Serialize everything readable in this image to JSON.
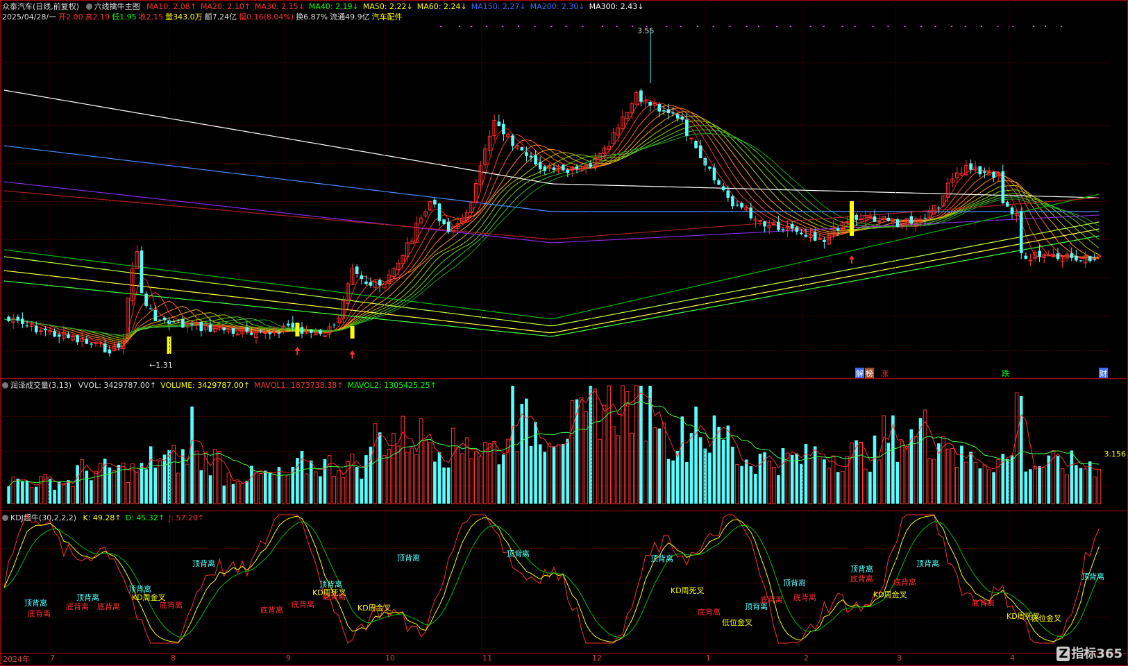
{
  "main_panel": {
    "stock_name": "众泰汽车(日线,前复权)",
    "indicator_name": "六线擒牛主图",
    "ma_items": [
      {
        "label": "MA10: 2.08",
        "arrow": "↑",
        "color": "#ff3030"
      },
      {
        "label": "MA20: 2.10",
        "arrow": "↑",
        "color": "#ff3030"
      },
      {
        "label": "MA30: 2.15",
        "arrow": "↓",
        "color": "#ff3030"
      },
      {
        "label": "MA40: 2.19",
        "arrow": "↓",
        "color": "#00ff00"
      },
      {
        "label": "MA50: 2.22",
        "arrow": "↓",
        "color": "#ffff00"
      },
      {
        "label": "MA60: 2.24",
        "arrow": "↓",
        "color": "#ffff00"
      },
      {
        "label": "MA150: 2.27",
        "arrow": "↓",
        "color": "#3a6bff"
      },
      {
        "label": "MA200: 2.30",
        "arrow": "↓",
        "color": "#3a6bff"
      },
      {
        "label": "MA300: 2.43",
        "arrow": "↓",
        "color": "#ffffff"
      }
    ],
    "info_line": [
      {
        "text": "2025/04/28/一",
        "color": "#dddddd"
      },
      {
        "text": "开2.00",
        "color": "#ff3030"
      },
      {
        "text": "高2.19",
        "color": "#ff3030"
      },
      {
        "text": "低1.95",
        "color": "#00ff00"
      },
      {
        "text": "收2.15",
        "color": "#ff3030"
      },
      {
        "text": "量343.0万",
        "color": "#ffff00"
      },
      {
        "text": "额7.24亿",
        "color": "#dddddd"
      },
      {
        "text": "幅0.16(8.04%)",
        "color": "#ff3030"
      },
      {
        "text": "换6.87%",
        "color": "#dddddd"
      },
      {
        "text": "流通49.9亿",
        "color": "#dddddd"
      },
      {
        "text": "汽车配件",
        "color": "#ffff00"
      }
    ],
    "price_high_label": "3.55",
    "price_low_label": "1.31",
    "badges": [
      "解",
      "榜",
      "涨",
      "跌",
      "财"
    ]
  },
  "volume_panel": {
    "name": "润泽成交量(3,13)",
    "items": [
      {
        "text": "VVOL: 3429787.00",
        "arrow": "↑",
        "color": "#dddddd"
      },
      {
        "text": "VOLUME: 3429787.00",
        "arrow": "↑",
        "color": "#ffff00"
      },
      {
        "text": "MAVOL1: 1873738.38",
        "arrow": "↑",
        "color": "#ff3030"
      },
      {
        "text": "MAVOL2: 1305425.25",
        "arrow": "↑",
        "color": "#00ff00"
      }
    ],
    "right_value": "3.156"
  },
  "kdj_panel": {
    "name": "KDJ超牛(30,2,2,2)",
    "items": [
      {
        "text": "K: 49.28",
        "arrow": "↑",
        "color": "#ffff00"
      },
      {
        "text": "D: 45.32",
        "arrow": "↑",
        "color": "#00ff00"
      },
      {
        "text": "J: 57.20",
        "arrow": "↑",
        "color": "#ff3030"
      }
    ],
    "annotations": {
      "top_div": "顶背离",
      "bottom_div": "底背离",
      "kd_dead": "KD周死叉",
      "kd_gold": "KD周金叉",
      "low_gold": "低位金叉"
    }
  },
  "date_axis": [
    "2024年",
    "7",
    "8",
    "9",
    "10",
    "11",
    "12",
    "1",
    "2",
    "3",
    "4"
  ],
  "watermark": "指标365",
  "colors": {
    "up": "#ff3030",
    "down": "#54ffff",
    "signal": "#ffff00"
  }
}
